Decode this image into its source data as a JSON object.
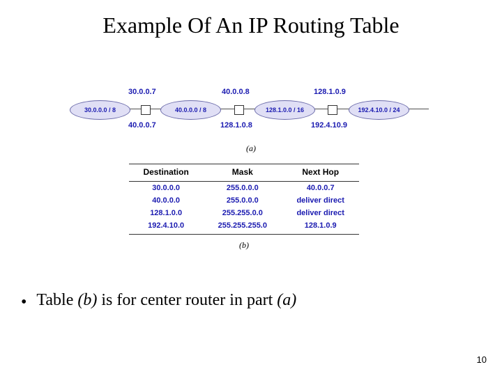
{
  "title": "Example Of An IP Routing Table",
  "figA": {
    "caption": "(a)",
    "networks": [
      {
        "label": "30.0.0.0 / 8"
      },
      {
        "label": "40.0.0.0 / 8"
      },
      {
        "label": "128.1.0.0 / 16"
      },
      {
        "label": "192.4.10.0 / 24"
      }
    ],
    "routers": [
      {
        "top_ip": "30.0.0.7",
        "bottom_ip": "40.0.0.7"
      },
      {
        "top_ip": "40.0.0.8",
        "bottom_ip": "128.1.0.8"
      },
      {
        "top_ip": "128.1.0.9",
        "bottom_ip": "192.4.10.9"
      }
    ]
  },
  "figB": {
    "caption": "(b)",
    "columns": [
      "Destination",
      "Mask",
      "Next Hop"
    ],
    "rows": [
      [
        "30.0.0.0",
        "255.0.0.0",
        "40.0.0.7"
      ],
      [
        "40.0.0.0",
        "255.0.0.0",
        "deliver direct"
      ],
      [
        "128.1.0.0",
        "255.255.0.0",
        "deliver direct"
      ],
      [
        "192.4.10.0",
        "255.255.255.0",
        "128.1.0.9"
      ]
    ]
  },
  "bullet": {
    "pre": "Table ",
    "it1": "(b)",
    "mid1": " is for center router in part ",
    "it2": "(a)"
  },
  "page_number": "10"
}
